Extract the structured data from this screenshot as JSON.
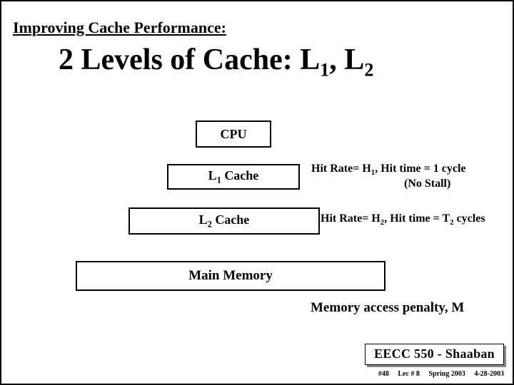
{
  "heading": "Improving Cache Performance:",
  "title": {
    "pre": "2 Levels of Cache:  L",
    "s1": "1",
    "mid": ", L",
    "s2": "2"
  },
  "boxes": {
    "cpu": "CPU",
    "l1": {
      "pre": "L",
      "sub": "1",
      "post": " Cache"
    },
    "l2": {
      "pre": "L",
      "sub": "2",
      "post": " Cache"
    },
    "mem": "Main Memory"
  },
  "notes": {
    "l1": {
      "line1": {
        "a": "Hit Rate= H",
        "s": "1",
        "b": ", Hit time = 1 cycle"
      },
      "line2": "(No Stall)"
    },
    "l2": {
      "a": "Hit Rate= H",
      "s1": "2",
      "b": ",  Hit time = T",
      "s2": "2",
      "c": "  cycles"
    },
    "mem": "Memory access penalty, M"
  },
  "footer": {
    "badge": "EECC 550 - Shaaban",
    "meta": {
      "num": "#48",
      "lec": "Lec # 8",
      "term": "Spring 2003",
      "date": "4-28-2003"
    }
  }
}
